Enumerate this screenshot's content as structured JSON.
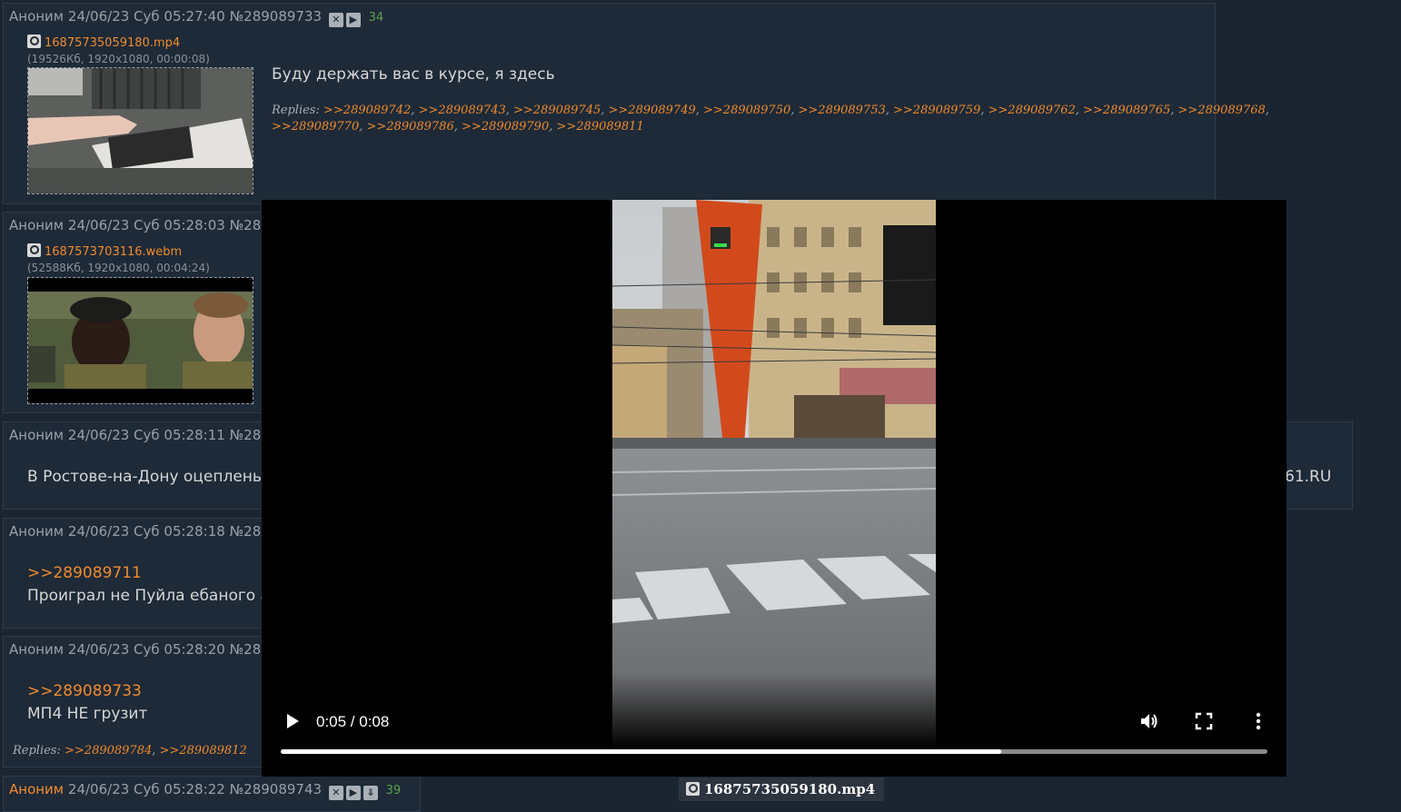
{
  "posts": [
    {
      "name": "Аноним",
      "date": "24/06/23 Суб 05:27:40",
      "num": "№289089733",
      "count": "34",
      "file": "16875735059180.mp4",
      "file_meta": "(19526Кб, 1920x1080, 00:00:08)",
      "text": "Буду держать вас в курсе, я здесь",
      "replies_label": "Replies:",
      "replies": [
        ">>289089742",
        ">>289089743",
        ">>289089745",
        ">>289089749",
        ">>289089750",
        ">>289089753",
        ">>289089759",
        ">>289089762",
        ">>289089765",
        ">>289089768",
        ">>289089770",
        ">>289089786",
        ">>289089790",
        ">>289089811"
      ]
    },
    {
      "name": "Аноним",
      "date": "24/06/23 Суб 05:28:03",
      "num": "№28",
      "file": "1687573703116.webm",
      "file_meta": "(52588Кб, 1920x1080, 00:04:24)"
    },
    {
      "name": "Аноним",
      "date": "24/06/23 Суб 05:28:11",
      "num": "№28",
      "text": "В Ростове-на-Дону оцеплены",
      "text_right": "61.RU"
    },
    {
      "name": "Аноним",
      "date": "24/06/23 Суб 05:28:18",
      "num": "№28",
      "ref": ">>289089711",
      "text": "Проиграл не Пуйла ебаного а"
    },
    {
      "name": "Аноним",
      "date": "24/06/23 Суб 05:28:20",
      "num": "№28",
      "ref": ">>289089733",
      "text": "МП4 НЕ грузит",
      "replies_label": "Replies:",
      "replies": [
        ">>289089784",
        ">>289089812"
      ]
    },
    {
      "name": "Аноним",
      "date": "24/06/23 Суб 05:28:22",
      "num": "№289089743",
      "count": "39"
    }
  ],
  "player": {
    "time": "0:05 / 0:08",
    "progress": 0.73,
    "caption": "16875735059180.mp4"
  },
  "colors": {
    "accent": "#f08b2c",
    "count": "#5fa04e",
    "bg": "#1b2531",
    "post_bg": "#1e2a38"
  },
  "icons": [
    "hide-icon",
    "play-icon",
    "download-icon",
    "search-icon",
    "volume-icon",
    "fullscreen-icon",
    "more-vert-icon"
  ]
}
